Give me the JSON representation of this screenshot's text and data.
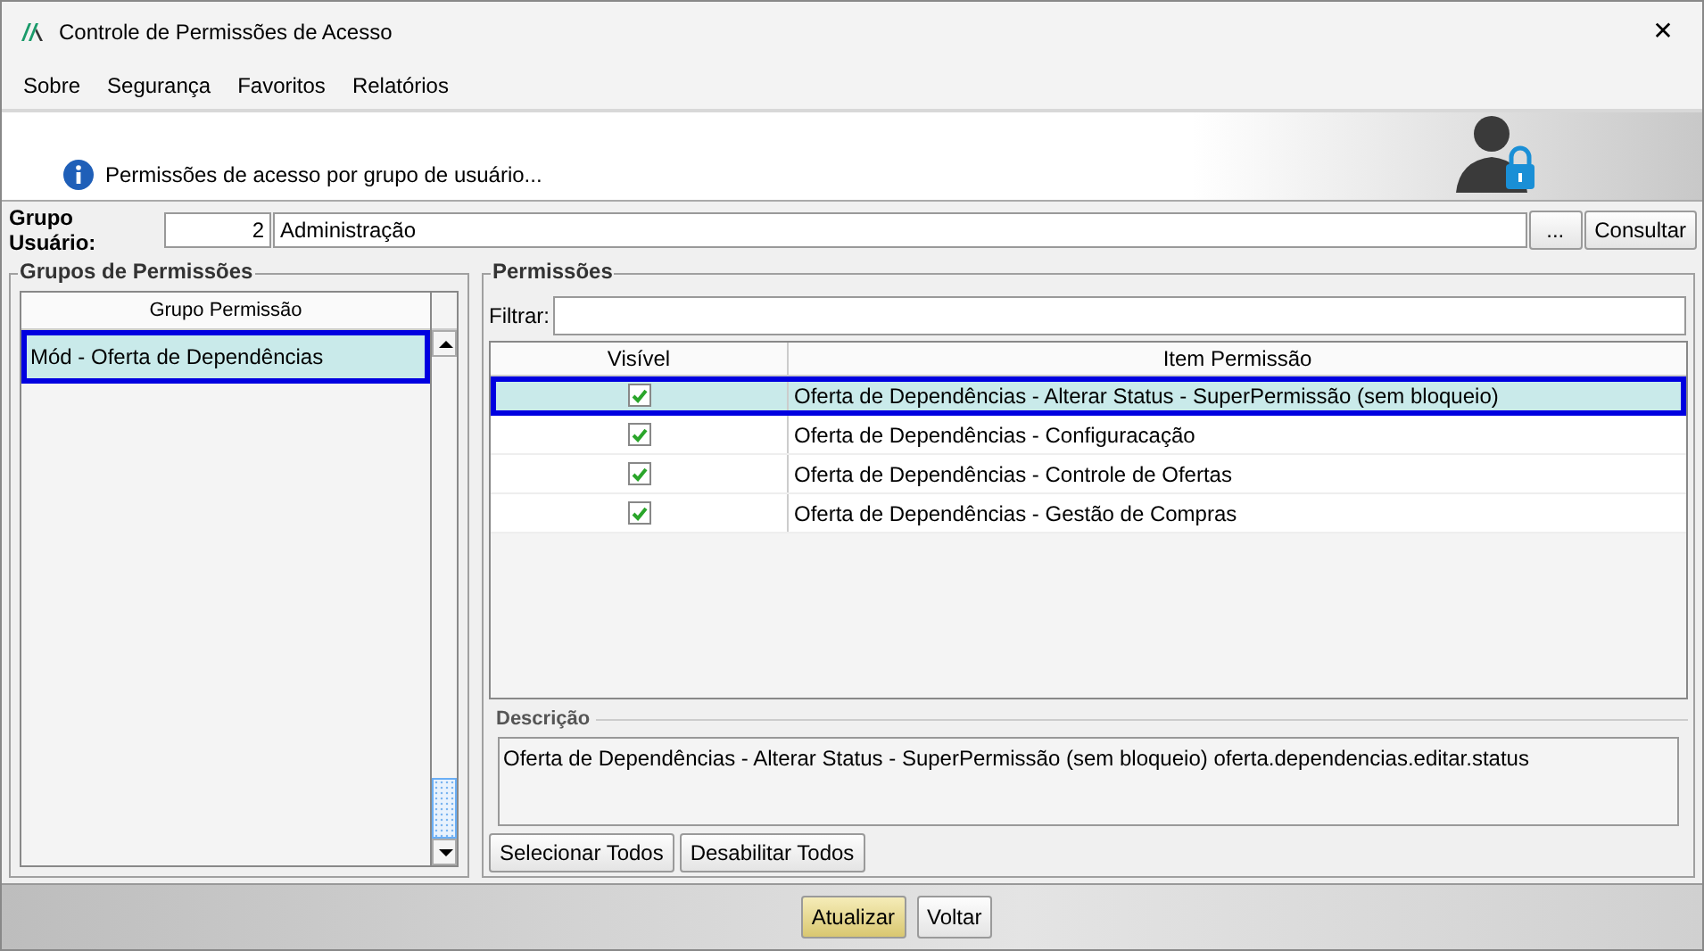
{
  "window": {
    "title": "Controle de Permissões de Acesso",
    "close": "✕"
  },
  "menu": [
    {
      "label": "Sobre"
    },
    {
      "label": "Segurança"
    },
    {
      "label": "Favoritos"
    },
    {
      "label": "Relatórios"
    }
  ],
  "banner": {
    "text": "Permissões de acesso por grupo de usuário..."
  },
  "user_group": {
    "label": "Grupo Usuário:",
    "code": "2",
    "name": "Administração",
    "browse": "...",
    "query": "Consultar"
  },
  "groups": {
    "title": "Grupos de Permissões",
    "column": "Grupo Permissão",
    "rows": [
      {
        "label": "Mód - Oferta de Dependências",
        "selected": true
      }
    ]
  },
  "permissions": {
    "title": "Permissões",
    "filter_label": "Filtrar:",
    "columns": [
      "Visível",
      "Item Permissão"
    ],
    "rows": [
      {
        "visible": true,
        "item": "Oferta de Dependências - Alterar Status - SuperPermissão (sem bloqueio)",
        "selected": true
      },
      {
        "visible": true,
        "item": "Oferta de Dependências - Configuracação",
        "selected": false
      },
      {
        "visible": true,
        "item": "Oferta de Dependências - Controle de Ofertas",
        "selected": false
      },
      {
        "visible": true,
        "item": "Oferta de Dependências - Gestão de Compras",
        "selected": false
      }
    ],
    "description_title": "Descrição",
    "description": "Oferta de Dependências - Alterar Status - SuperPermissão (sem bloqueio) oferta.dependencias.editar.status",
    "buttons": [
      "Selecionar Todos",
      "Desabilitar Todos"
    ]
  },
  "footer_buttons": [
    {
      "label": "Atualizar",
      "kind": "primary"
    },
    {
      "label": "Voltar",
      "kind": "normal"
    }
  ]
}
